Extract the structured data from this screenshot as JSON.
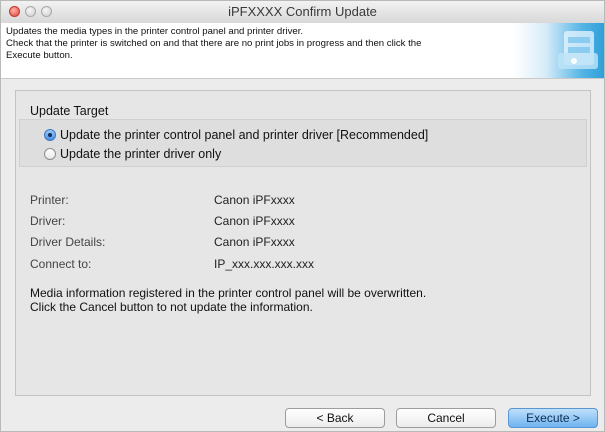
{
  "window": {
    "title": "iPFXXXX Confirm Update"
  },
  "header": {
    "lines": [
      "Updates the media types in the printer control panel and printer driver.",
      "Check that the printer is switched on and that there are no print jobs in progress and then click the",
      "Execute button."
    ]
  },
  "update_target": {
    "label": "Update Target",
    "options": [
      {
        "label": "Update the printer control panel and printer driver [Recommended]",
        "selected": true
      },
      {
        "label": "Update the printer driver only",
        "selected": false
      }
    ]
  },
  "info": [
    {
      "label": "Printer:",
      "value": "Canon iPFxxxx"
    },
    {
      "label": "Driver:",
      "value": "Canon iPFxxxx"
    },
    {
      "label": "Driver Details:",
      "value": "Canon iPFxxxx"
    },
    {
      "label": "Connect to:",
      "value": "IP_xxx.xxx.xxx.xxx"
    }
  ],
  "message": {
    "line1": "Media information registered in the printer control panel will be overwritten.",
    "line2": "Click the Cancel button to not update the information."
  },
  "buttons": {
    "back": "< Back",
    "cancel": "Cancel",
    "execute": "Execute >"
  }
}
